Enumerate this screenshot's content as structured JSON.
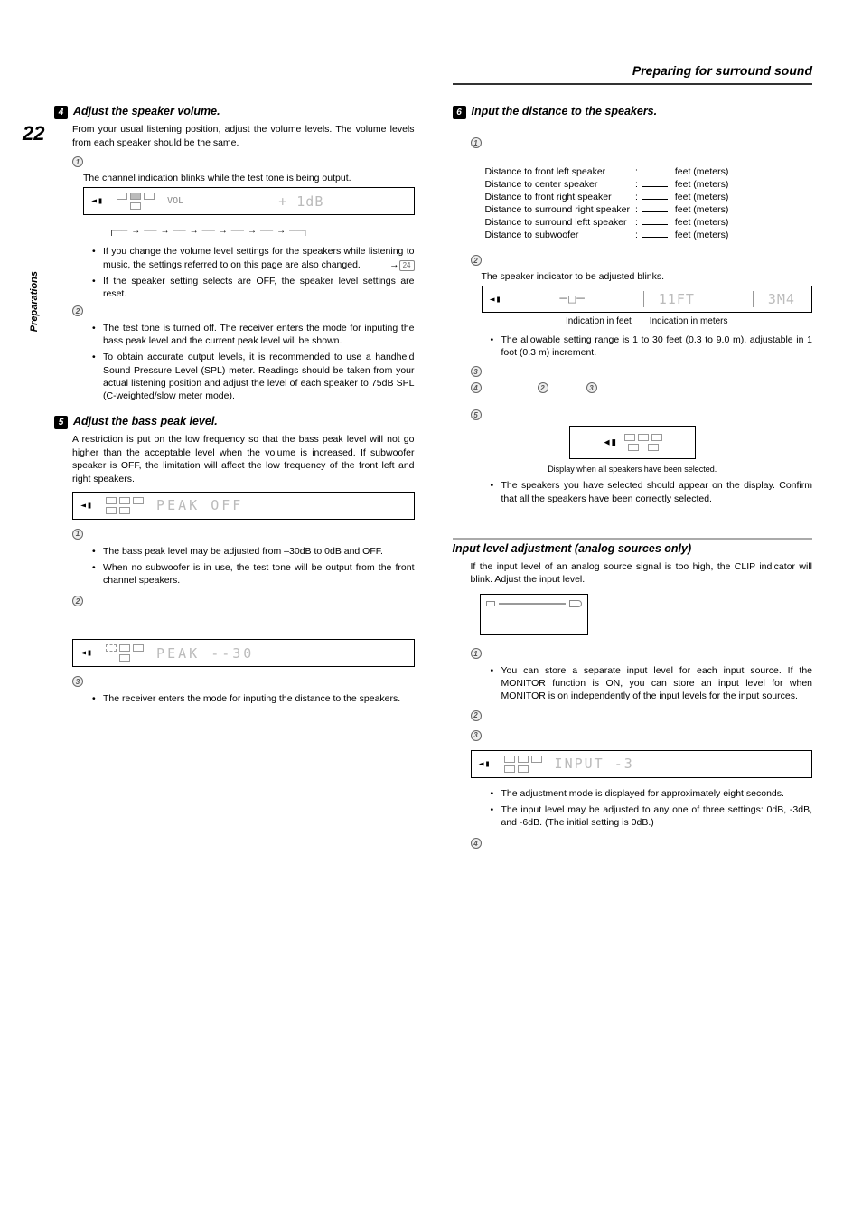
{
  "page": {
    "number": "22",
    "sidebar_tab": "Preparations",
    "section_title": "Preparing for surround sound"
  },
  "col1": {
    "step4": {
      "num": "4",
      "title": "Adjust the speaker volume.",
      "intro": "From your usual listening position, adjust the volume levels. The volume levels from each speaker should be the same."
    },
    "sub1": {
      "caption": "The channel indication blinks while the test tone is being output.",
      "lcd_left": "VOL",
      "lcd_right": "+ 1dB",
      "bullets": [
        "If  you change the volume level settings for the speakers while listening to music, the settings referred to on this page are also changed.",
        "If the speaker setting selects are OFF, the speaker level settings are reset."
      ],
      "ref": "24"
    },
    "sub2": {
      "bullets": [
        "The test tone is turned off. The receiver enters the mode for inputing the bass peak level and the current peak level will be shown.",
        "To obtain accurate output levels, it is recommended to use a handheld Sound Pressure Level (SPL) meter. Readings should be taken from your actual listening position and adjust the level of each speaker to 75dB SPL (C-weighted/slow meter mode)."
      ]
    },
    "step5": {
      "num": "5",
      "title": "Adjust the bass peak level.",
      "intro": "A restriction is put on the low frequency so that the bass peak level will not go higher than the acceptable level when the volume is increased. If subwoofer speaker is OFF, the limitation will affect the low frequency of the front left and right speakers.",
      "lcd1": "PEAK  OFF"
    },
    "s5_sub1": {
      "bullets": [
        "The bass peak level may be adjusted from –30dB to 0dB and OFF.",
        "When no subwoofer is in use, the test tone will be output from the front channel speakers."
      ]
    },
    "s5_sub2_lcd": "PEAK  --30",
    "s5_sub3": {
      "bullets": [
        "The receiver enters the mode for inputing the distance to the speakers."
      ]
    }
  },
  "col2": {
    "step6": {
      "num": "6",
      "title": "Input the distance to the speakers."
    },
    "dist_rows": [
      {
        "label": "Distance to front left speaker",
        "units": "feet (meters)"
      },
      {
        "label": "Distance to center speaker",
        "units": "feet (meters)"
      },
      {
        "label": "Distance to front right  speaker",
        "units": "feet (meters)"
      },
      {
        "label": "Distance to surround right speaker",
        "units": "feet (meters)"
      },
      {
        "label": "Distance to surround leftt speaker",
        "units": "feet (meters)"
      },
      {
        "label": "Distance to subwoofer",
        "units": "feet (meters)"
      }
    ],
    "s6_sub2": {
      "caption": "The speaker indicator to be adjusted blinks.",
      "lcd_left": "11FT",
      "lcd_right": "3M4",
      "foot_left": "Indication in feet",
      "foot_right": "Indication in meters",
      "bullets": [
        "The allowable setting range is 1 to 30 feet (0.3 to 9.0 m), adjustable in 1 foot (0.3 m) increment."
      ]
    },
    "s6_sub5": {
      "caption": "Display when all speakers have been selected.",
      "bullets": [
        "The speakers you have selected should appear on the display. Confirm that all the speakers have been correctly selected."
      ]
    },
    "input_lvl": {
      "title": "Input level adjustment (analog sources only)",
      "intro": "If the input level of an analog source signal is too high, the CLIP indicator will blink. Adjust the input level.",
      "sub1_bullets": [
        "You can store a separate input level for each input source. If the MONITOR function is ON, you can store an input level for when MONITOR is on independently of the input levels for the input sources."
      ],
      "lcd": "INPUT   -3",
      "notes": [
        "The adjustment mode is displayed for approximately eight seconds.",
        "The input level may be adjusted to any one of three settings: 0dB, -3dB, and -6dB. (The initial setting is 0dB.)"
      ]
    }
  }
}
